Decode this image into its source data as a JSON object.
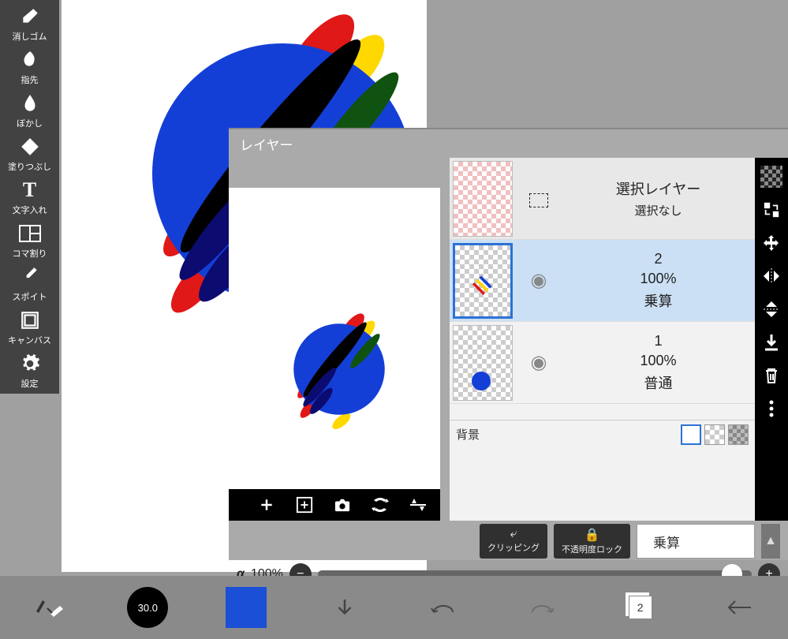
{
  "tools": {
    "eraser": "消しゴム",
    "smudge": "指先",
    "blur": "ぼかし",
    "fill": "塗りつぶし",
    "text": "文字入れ",
    "frame": "コマ割り",
    "eyedropper": "スポイト",
    "canvas": "キャンバス",
    "settings": "設定"
  },
  "layer_panel": {
    "title": "レイヤー",
    "selection_layer": "選択レイヤー",
    "no_selection": "選択なし",
    "background": "背景",
    "clipping": "クリッピング",
    "opacity_lock": "不透明度ロック",
    "blend_mode": "乗算",
    "alpha_label": "α",
    "alpha_value": "100%",
    "layers": [
      {
        "name": "2",
        "opacity": "100%",
        "blend": "乗算"
      },
      {
        "name": "1",
        "opacity": "100%",
        "blend": "普通"
      }
    ]
  },
  "bottom": {
    "brush_size": "30.0",
    "layer_count": "2"
  }
}
